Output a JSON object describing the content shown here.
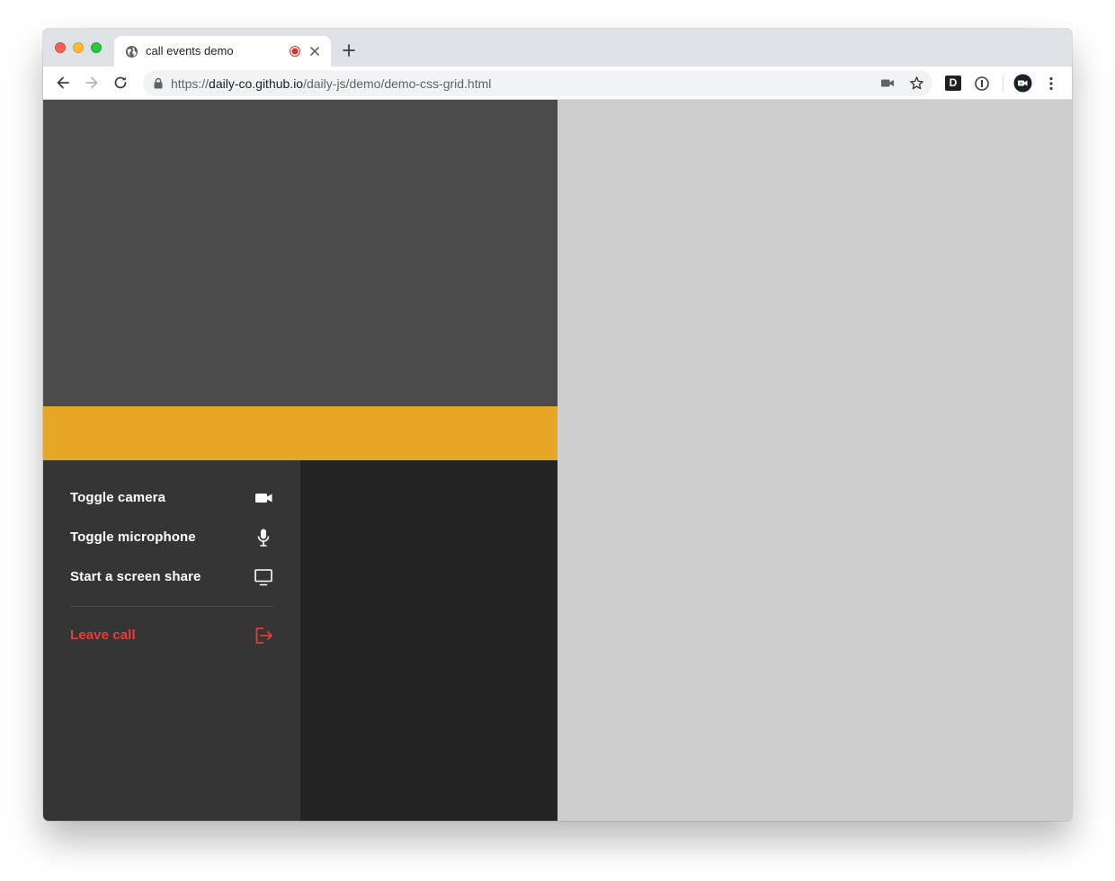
{
  "browser": {
    "tab": {
      "title": "call events demo",
      "favicon": "globe-icon",
      "indicator": "recording-dot-icon",
      "close": "close-icon"
    },
    "new_tab": "plus-icon",
    "address_bar": {
      "scheme": "https://",
      "host": "daily-co.github.io",
      "path": "/daily-js/demo/demo-css-grid.html"
    },
    "toolbar_icons": [
      "back-icon",
      "forward-icon",
      "reload-icon",
      "lock-icon",
      "camera-icon",
      "star-icon",
      "d-extension-icon",
      "info-extension-icon",
      "daily-extension-icon",
      "kebab-menu-icon"
    ],
    "d_extension_letter": "D"
  },
  "controls": {
    "items": [
      {
        "label": "Toggle camera",
        "icon": "camera-icon"
      },
      {
        "label": "Toggle microphone",
        "icon": "microphone-icon"
      },
      {
        "label": "Start a screen share",
        "icon": "monitor-icon"
      }
    ],
    "leave": {
      "label": "Leave call",
      "icon": "leave-icon"
    }
  },
  "colors": {
    "video_tile": "#4b4b4b",
    "accent": "#e6a727",
    "controls_bg": "#353535",
    "dark_panel": "#242424",
    "right_panel": "#cecece",
    "leave": "#ef3b34"
  }
}
